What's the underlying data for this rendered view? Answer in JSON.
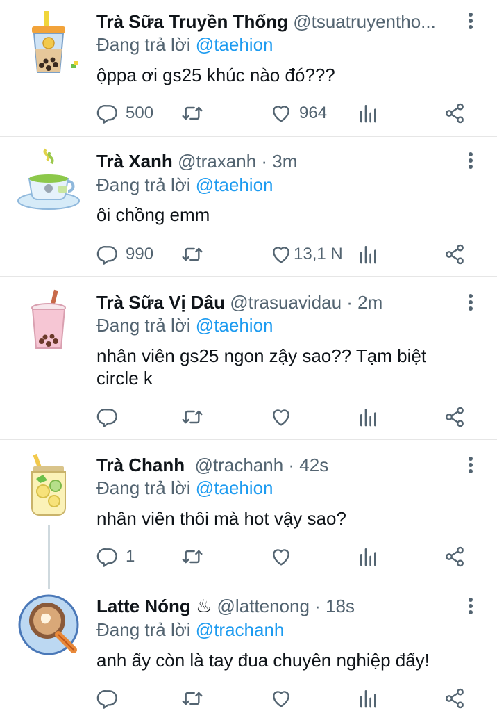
{
  "tweets": [
    {
      "name": "Trà Sữa Truyền Thống",
      "handle": "@tsuatruyentho...",
      "time": "",
      "replying_prefix": "Đang trả lời",
      "replying_to": "@taehion",
      "text": "ộppa ơi gs25 khúc nào đó???",
      "avatar_icon": "bubble-tea-cup-icon",
      "replies": "500",
      "retweets": "",
      "likes": "964"
    },
    {
      "name": "Trà Xanh",
      "handle": "@traxanh",
      "time": " · 3m",
      "replying_prefix": "Đang trả lời",
      "replying_to": "@taehion",
      "text": "ôi chồng emm",
      "avatar_icon": "green-tea-cup-icon",
      "replies": "990",
      "retweets": "",
      "likes": "13,1 N"
    },
    {
      "name": "Trà Sữa Vị Dâu",
      "handle": "@trasuavidau",
      "time": " · 2m",
      "replying_prefix": "Đang trả lời",
      "replying_to": "@taehion",
      "text": "nhân viên gs25 ngon zậy sao?? Tạm biệt circle k",
      "avatar_icon": "strawberry-milk-tea-icon",
      "replies": "",
      "retweets": "",
      "likes": ""
    },
    {
      "name": "Trà Chanh",
      "handle": "@trachanh",
      "time": " · 42s",
      "replying_prefix": "Đang trả lời",
      "replying_to": "@taehion",
      "text": "nhân viên thôi mà hot vậy sao?",
      "avatar_icon": "lemon-tea-jar-icon",
      "replies": "1",
      "retweets": "",
      "likes": ""
    },
    {
      "name": "Latte Nóng ♨",
      "handle": "@lattenong",
      "time": " · 18s",
      "replying_prefix": "Đang trả lời",
      "replying_to": "@trachanh",
      "text": "anh ấy còn là tay đua chuyên nghiệp đấy!",
      "avatar_icon": "hot-latte-cup-icon",
      "replies": "",
      "retweets": "",
      "likes": ""
    }
  ],
  "colors": {
    "accent": "#1d9bf0",
    "muted": "#536471",
    "divider": "#e6e6e6"
  }
}
